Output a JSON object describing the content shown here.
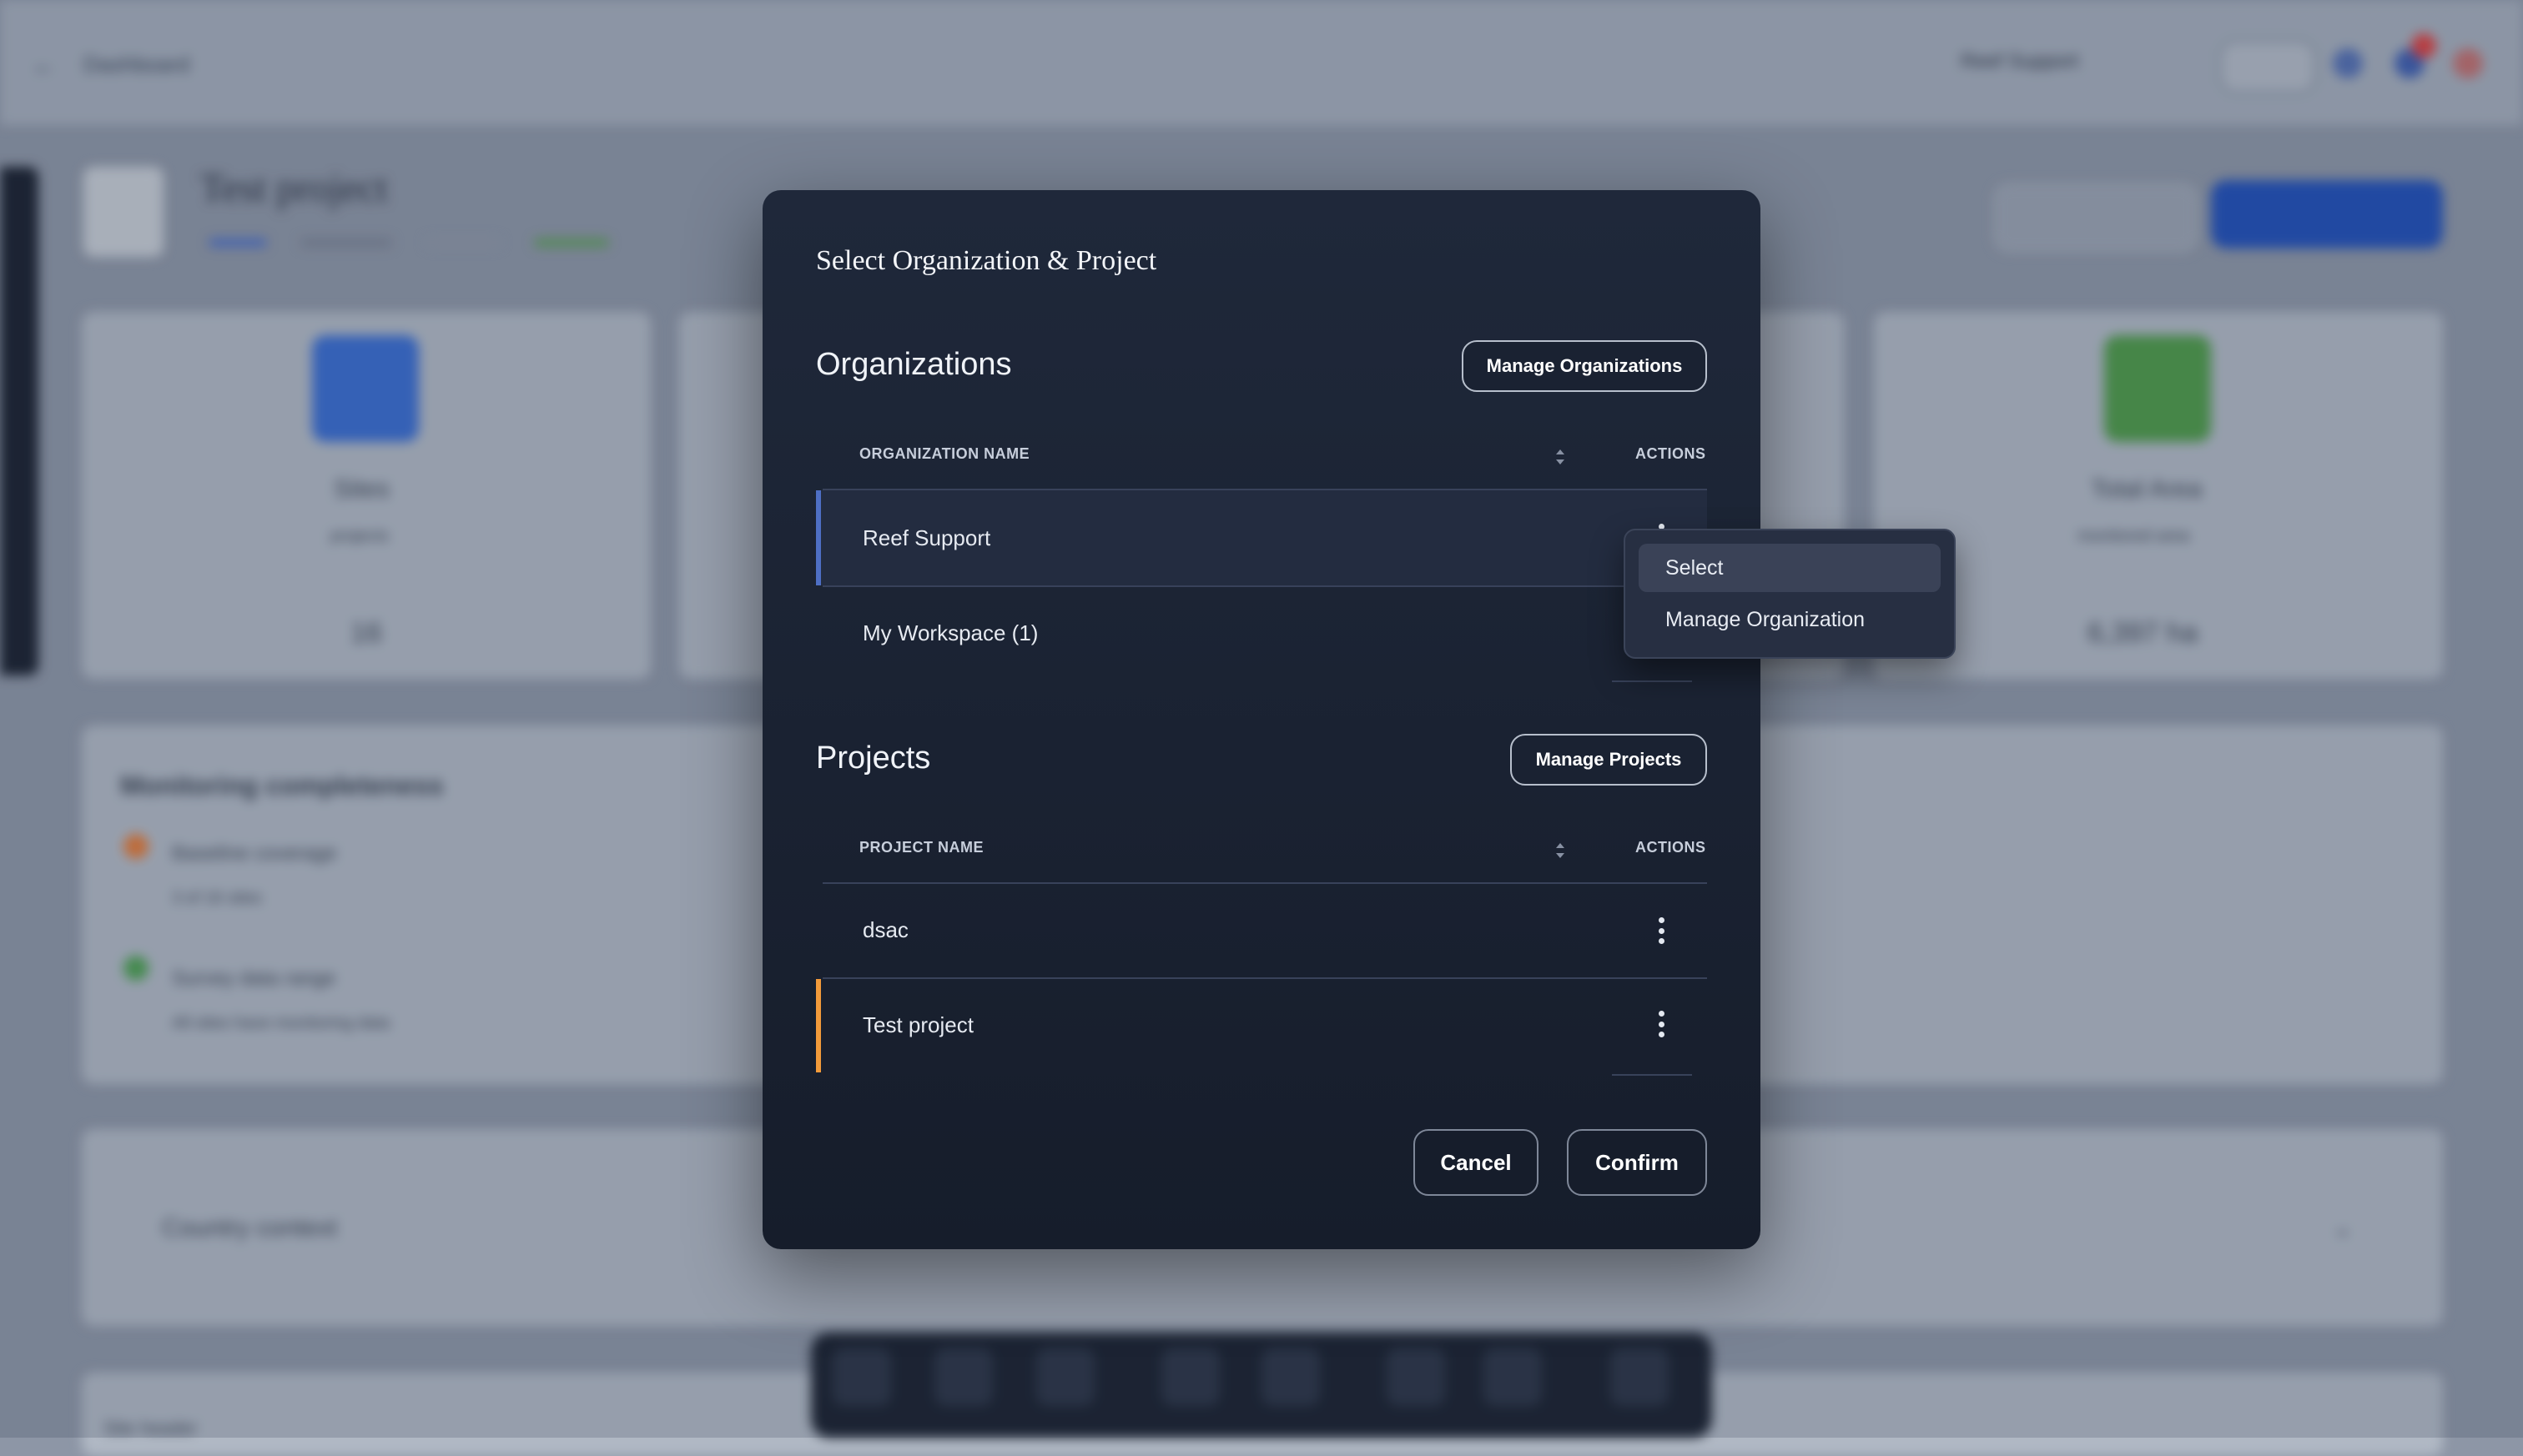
{
  "modal": {
    "title": "Select Organization & Project",
    "organizations": {
      "heading": "Organizations",
      "manage_label": "Manage Organizations",
      "col_name": "ORGANIZATION NAME",
      "col_actions": "ACTIONS",
      "rows": [
        {
          "name": "Reef Support",
          "selected": true
        },
        {
          "name": "My Workspace (1)",
          "selected": false
        }
      ]
    },
    "projects": {
      "heading": "Projects",
      "manage_label": "Manage Projects",
      "col_name": "PROJECT NAME",
      "col_actions": "ACTIONS",
      "rows": [
        {
          "name": "dsac",
          "selected": false
        },
        {
          "name": "Test project",
          "selected": true
        }
      ]
    },
    "cancel_label": "Cancel",
    "confirm_label": "Confirm"
  },
  "context_menu": {
    "items": [
      "Select",
      "Manage Organization"
    ],
    "highlighted": "Select"
  },
  "background_page": {
    "breadcrumb": "Dashboard",
    "user": "Reef Support",
    "project_title": "Test project",
    "cards": [
      {
        "title": "Sites",
        "subtitle": "projects",
        "value": "16"
      },
      {
        "title": "Total Area",
        "subtitle": "monitored area",
        "value": "6,397 ha"
      }
    ],
    "monitoring_title": "Monitoring completeness",
    "monitoring_items": [
      {
        "label": "Baseline coverage",
        "detail": "3 of 16 sites"
      },
      {
        "label": "Survey data range",
        "detail": "All sites have monitoring data"
      }
    ],
    "country_context": "Country context",
    "site_header": "Site header"
  },
  "colors": {
    "modal_bg": "#1c2434",
    "org_accent": "#4e6fc4",
    "project_accent": "#f29a3a",
    "primary_button": "#2250b8"
  }
}
